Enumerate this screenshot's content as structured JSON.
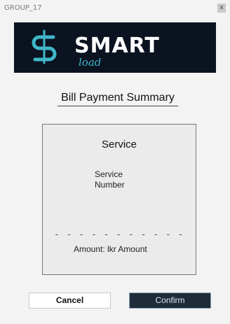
{
  "window": {
    "title": "GROUP_17",
    "close_label": "x"
  },
  "brand": {
    "name": "SMART",
    "sub": "load",
    "accent_color": "#3fb6c8",
    "logo_icon": "dollar-s-icon"
  },
  "page": {
    "title": "Bill Payment Summary"
  },
  "card": {
    "heading": "Service",
    "service_number_line1": "Service",
    "service_number_line2": "Number",
    "divider": "- - - - - - - - - - - - - - - -",
    "amount_label": "Amount: lkr",
    "amount_value": "Amount"
  },
  "actions": {
    "cancel_label": "Cancel",
    "confirm_label": "Confirm"
  }
}
